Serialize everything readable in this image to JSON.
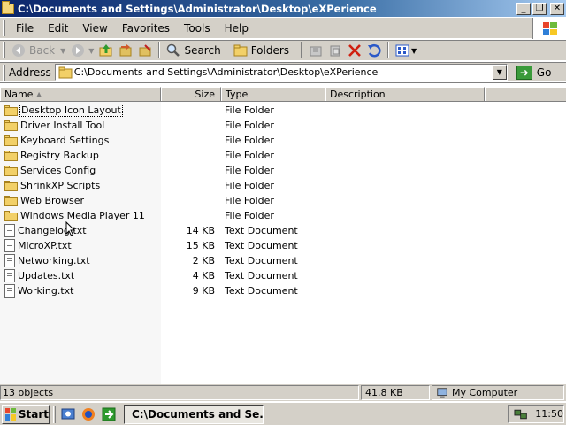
{
  "window": {
    "title": "C:\\Documents and Settings\\Administrator\\Desktop\\eXPerience",
    "minimize_label": "_",
    "restore_label": "❐",
    "close_label": "✕"
  },
  "menu": [
    "File",
    "Edit",
    "View",
    "Favorites",
    "Tools",
    "Help"
  ],
  "toolbar": {
    "back_label": "Back",
    "search_label": "Search",
    "folders_label": "Folders"
  },
  "address": {
    "label": "Address",
    "value": "C:\\Documents and Settings\\Administrator\\Desktop\\eXPerience",
    "go_label": "Go"
  },
  "columns": [
    "Name",
    "Size",
    "Type",
    "Description"
  ],
  "files": [
    {
      "name": "Desktop Icon Layout",
      "size": "",
      "type": "File Folder",
      "kind": "folder",
      "focused": true
    },
    {
      "name": "Driver Install Tool",
      "size": "",
      "type": "File Folder",
      "kind": "folder"
    },
    {
      "name": "Keyboard Settings",
      "size": "",
      "type": "File Folder",
      "kind": "folder"
    },
    {
      "name": "Registry Backup",
      "size": "",
      "type": "File Folder",
      "kind": "folder"
    },
    {
      "name": "Services Config",
      "size": "",
      "type": "File Folder",
      "kind": "folder"
    },
    {
      "name": "ShrinkXP Scripts",
      "size": "",
      "type": "File Folder",
      "kind": "folder"
    },
    {
      "name": "Web Browser",
      "size": "",
      "type": "File Folder",
      "kind": "folder"
    },
    {
      "name": "Windows Media Player 11",
      "size": "",
      "type": "File Folder",
      "kind": "folder"
    },
    {
      "name": "Changelog.txt",
      "size": "14 KB",
      "type": "Text Document",
      "kind": "text"
    },
    {
      "name": "MicroXP.txt",
      "size": "15 KB",
      "type": "Text Document",
      "kind": "text"
    },
    {
      "name": "Networking.txt",
      "size": "2 KB",
      "type": "Text Document",
      "kind": "text"
    },
    {
      "name": "Updates.txt",
      "size": "4 KB",
      "type": "Text Document",
      "kind": "text"
    },
    {
      "name": "Working.txt",
      "size": "9 KB",
      "type": "Text Document",
      "kind": "text"
    }
  ],
  "status": {
    "objects": "13 objects",
    "size": "41.8 KB",
    "location": "My Computer"
  },
  "taskbar": {
    "start_label": "Start",
    "task_label": "C:\\Documents and Se...",
    "clock": "11:50"
  }
}
